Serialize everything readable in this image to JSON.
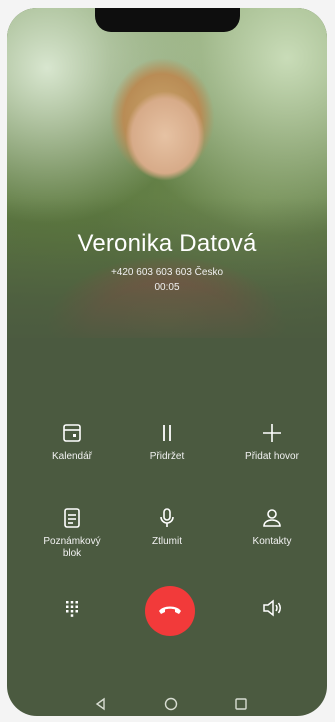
{
  "caller": {
    "name": "Veronika Datová",
    "number_line": "+420 603 603 603  Česko",
    "duration": "00:05"
  },
  "actions": {
    "calendar": {
      "label": "Kalendář",
      "icon": "calendar-icon"
    },
    "hold": {
      "label": "Přidržet",
      "icon": "pause-icon"
    },
    "add_call": {
      "label": "Přidat hovor",
      "icon": "plus-icon"
    },
    "notepad": {
      "label": "Poznámkový blok",
      "icon": "notepad-icon"
    },
    "mute": {
      "label": "Ztlumit",
      "icon": "microphone-icon"
    },
    "contacts": {
      "label": "Kontakty",
      "icon": "person-icon"
    }
  },
  "controls": {
    "dialpad_icon": "dialpad-icon",
    "end_call_icon": "hang-up-icon",
    "speaker_icon": "speaker-icon"
  },
  "navbar": {
    "back_icon": "back-triangle-icon",
    "home_icon": "home-circle-icon",
    "recents_icon": "recents-square-icon"
  },
  "colors": {
    "background": "#4b5a40",
    "end_call": "#f23a3a",
    "text": "#ffffff"
  }
}
